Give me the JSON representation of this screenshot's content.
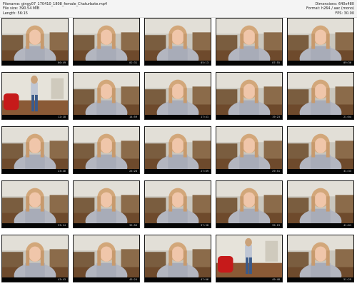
{
  "header": {
    "filename_line": "Filename: gingy07_170410_1808_female_Chaturbate.mp4",
    "filesize_line": "File size: 390.54 MiB",
    "length_line": "Length: 56:15",
    "dimensions_line": "Dimensions: 640x480",
    "format_line": "Format: h264 / aac (mono)",
    "fps_line": "FPS: 30.00"
  },
  "thumbnails": [
    {
      "time": "00:49",
      "scene": "cam"
    },
    {
      "time": "02:31",
      "scene": "cam"
    },
    {
      "time": "05:13",
      "scene": "cam"
    },
    {
      "time": "07:55",
      "scene": "cam"
    },
    {
      "time": "09:36",
      "scene": "cam"
    },
    {
      "time": "12:18",
      "scene": "standing"
    },
    {
      "time": "14:59",
      "scene": "cam"
    },
    {
      "time": "17:41",
      "scene": "cam"
    },
    {
      "time": "19:23",
      "scene": "cam"
    },
    {
      "time": "21:04",
      "scene": "cam"
    },
    {
      "time": "23:46",
      "scene": "cam"
    },
    {
      "time": "25:28",
      "scene": "cam"
    },
    {
      "time": "27:09",
      "scene": "cam"
    },
    {
      "time": "29:51",
      "scene": "cam"
    },
    {
      "time": "31:33",
      "scene": "cam"
    },
    {
      "time": "33:14",
      "scene": "cam"
    },
    {
      "time": "35:56",
      "scene": "cam"
    },
    {
      "time": "37:38",
      "scene": "cam"
    },
    {
      "time": "39:19",
      "scene": "cam"
    },
    {
      "time": "41:01",
      "scene": "cam"
    },
    {
      "time": "43:43",
      "scene": "cam"
    },
    {
      "time": "45:24",
      "scene": "cam"
    },
    {
      "time": "47:06",
      "scene": "cam"
    },
    {
      "time": "49:48",
      "scene": "standing"
    },
    {
      "time": "51:29",
      "scene": "cam"
    }
  ]
}
